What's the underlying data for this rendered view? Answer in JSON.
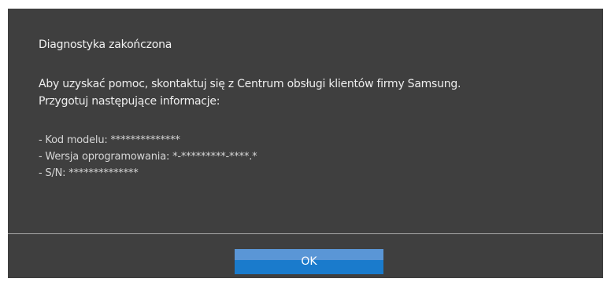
{
  "dialog": {
    "title": "Diagnostyka zakończona",
    "message_lines": [
      "Aby uzyskać pomoc, skontaktuj się z Centrum obsługi klientów firmy Samsung.",
      "Przygotuj następujące informacje:"
    ],
    "details": [
      "- Kod modelu: **************",
      "- Wersja oprogramowania: *-*********-****.*",
      "- S/N: **************"
    ],
    "ok_label": "OK"
  },
  "colors": {
    "dialog_background": "#3f3f3f",
    "button_top": "#5a96d6",
    "button_bottom": "#1a7bcc",
    "divider": "#a8a8a8"
  }
}
